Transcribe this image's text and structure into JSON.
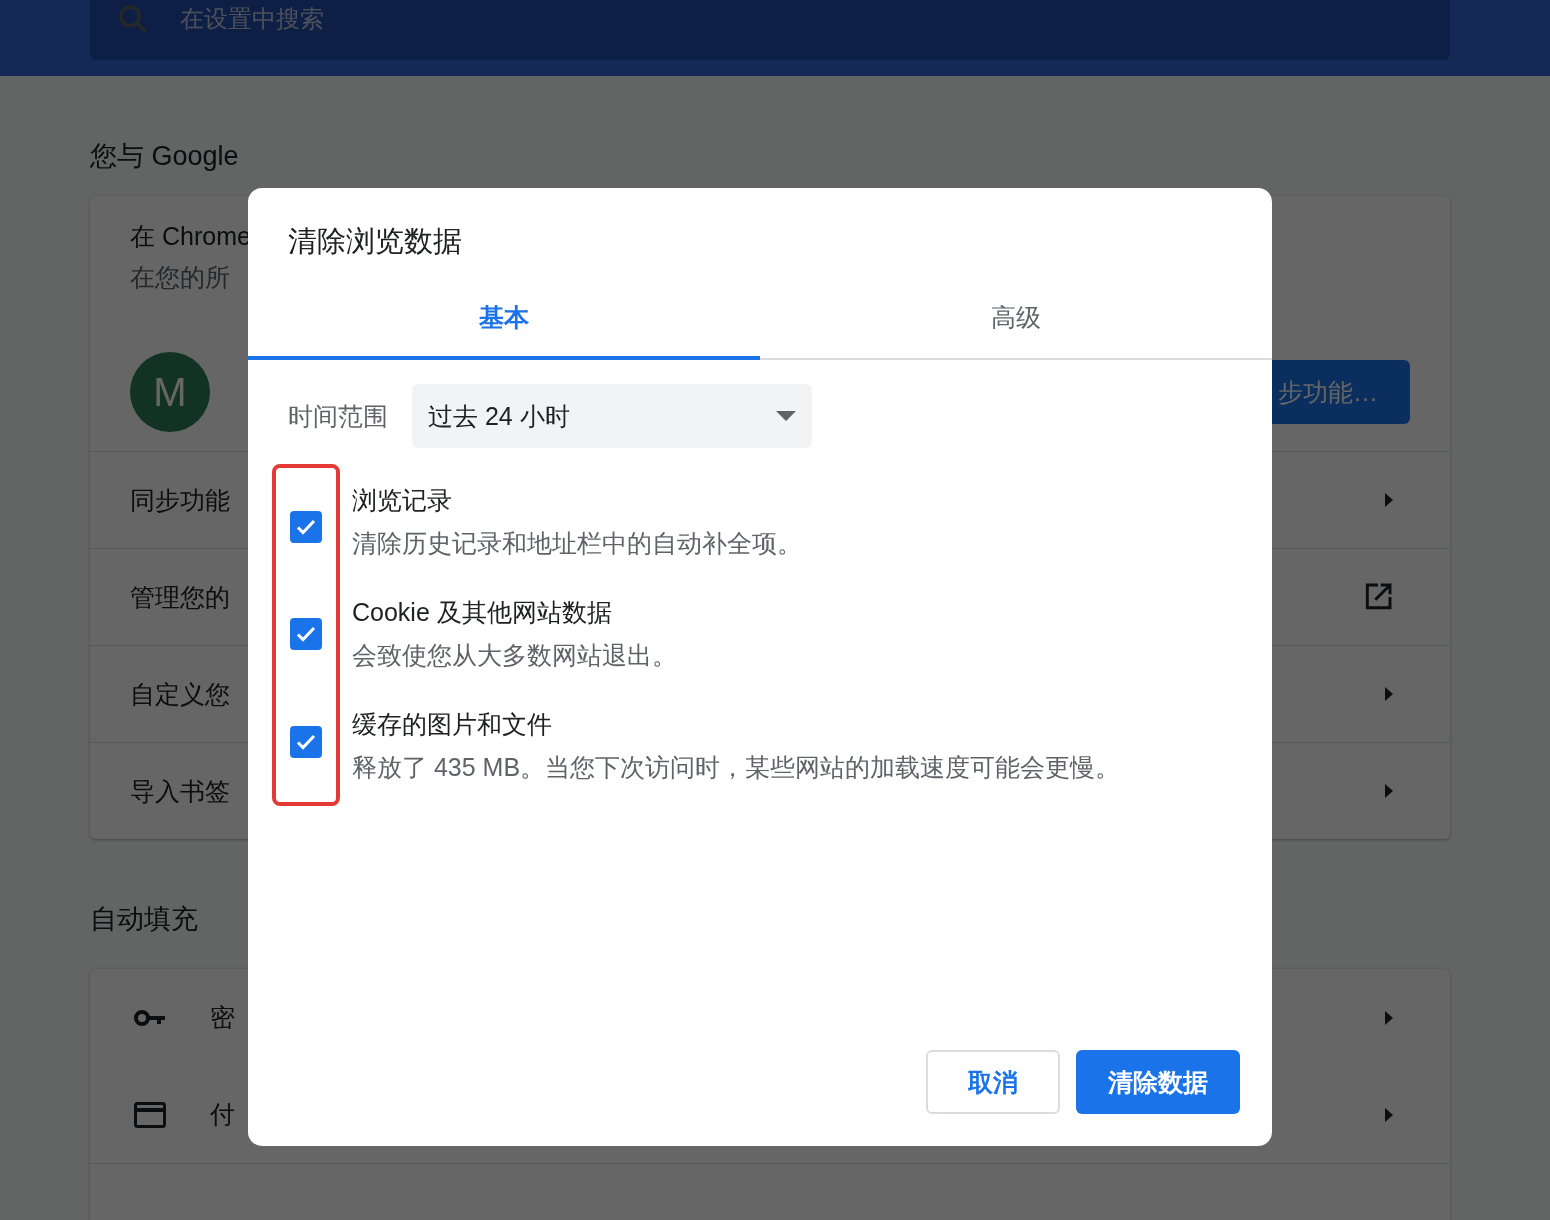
{
  "header": {
    "search": {
      "placeholder": "在设置中搜索"
    }
  },
  "you_and_google": {
    "title": "您与 Google",
    "sync_card": {
      "title": "在 Chrome",
      "subtitle": "在您的所",
      "avatar_letter": "M",
      "sync_button": "步功能…"
    },
    "rows": [
      {
        "label": "同步功能"
      },
      {
        "label": "管理您的"
      },
      {
        "label": "自定义您"
      },
      {
        "label": "导入书签"
      }
    ]
  },
  "autofill": {
    "title": "自动填充",
    "rows": [
      {
        "label": "密"
      },
      {
        "label": "付"
      }
    ]
  },
  "dialog": {
    "title": "清除浏览数据",
    "tabs": [
      {
        "label": "基本",
        "selected": true
      },
      {
        "label": "高级",
        "selected": false
      }
    ],
    "time_range": {
      "label": "时间范围",
      "value": "过去 24 小时"
    },
    "options": [
      {
        "title": "浏览记录",
        "description": "清除历史记录和地址栏中的自动补全项。",
        "checked": true
      },
      {
        "title": "Cookie 及其他网站数据",
        "description": "会致使您从大多数网站退出。",
        "checked": true
      },
      {
        "title": "缓存的图片和文件",
        "description": "释放了 435 MB。当您下次访问时，某些网站的加载速度可能会更慢。",
        "checked": true
      }
    ],
    "buttons": [
      {
        "label": "取消",
        "kind": "secondary"
      },
      {
        "label": "清除数据",
        "kind": "primary"
      }
    ]
  }
}
